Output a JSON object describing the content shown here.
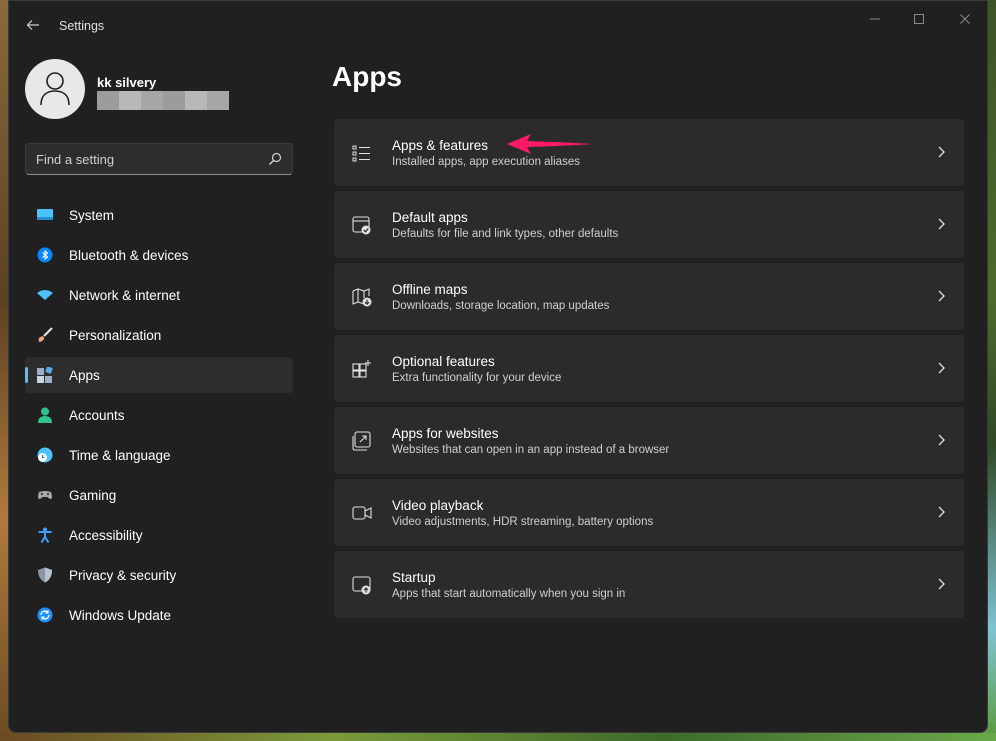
{
  "window": {
    "title": "Settings"
  },
  "profile": {
    "name": "kk silvery"
  },
  "search": {
    "placeholder": "Find a setting"
  },
  "sidebar": {
    "items": [
      {
        "label": "System",
        "icon": "system-icon",
        "color": "#4cc2ff"
      },
      {
        "label": "Bluetooth & devices",
        "icon": "bluetooth-icon",
        "color": "#0a84ff"
      },
      {
        "label": "Network & internet",
        "icon": "wifi-icon",
        "color": "#4cc2ff"
      },
      {
        "label": "Personalization",
        "icon": "brush-icon",
        "color": "#e8a87c"
      },
      {
        "label": "Apps",
        "icon": "apps-icon",
        "color": "#9ab0c8",
        "active": true
      },
      {
        "label": "Accounts",
        "icon": "accounts-icon",
        "color": "#2fc28a"
      },
      {
        "label": "Time & language",
        "icon": "globe-clock-icon",
        "color": "#4cc2ff"
      },
      {
        "label": "Gaming",
        "icon": "gamepad-icon",
        "color": "#a8a8a8"
      },
      {
        "label": "Accessibility",
        "icon": "accessibility-icon",
        "color": "#3aa0ff"
      },
      {
        "label": "Privacy & security",
        "icon": "shield-icon",
        "color": "#8a96a6"
      },
      {
        "label": "Windows Update",
        "icon": "update-icon",
        "color": "#1e90ff"
      }
    ]
  },
  "main": {
    "title": "Apps",
    "cards": [
      {
        "title": "Apps & features",
        "subtitle": "Installed apps, app execution aliases",
        "icon": "list-icon"
      },
      {
        "title": "Default apps",
        "subtitle": "Defaults for file and link types, other defaults",
        "icon": "default-apps-icon"
      },
      {
        "title": "Offline maps",
        "subtitle": "Downloads, storage location, map updates",
        "icon": "map-download-icon"
      },
      {
        "title": "Optional features",
        "subtitle": "Extra functionality for your device",
        "icon": "grid-plus-icon"
      },
      {
        "title": "Apps for websites",
        "subtitle": "Websites that can open in an app instead of a browser",
        "icon": "open-external-icon"
      },
      {
        "title": "Video playback",
        "subtitle": "Video adjustments, HDR streaming, battery options",
        "icon": "video-icon"
      },
      {
        "title": "Startup",
        "subtitle": "Apps that start automatically when you sign in",
        "icon": "startup-icon"
      }
    ]
  },
  "annotation": {
    "arrow_color": "#ff1a66"
  }
}
